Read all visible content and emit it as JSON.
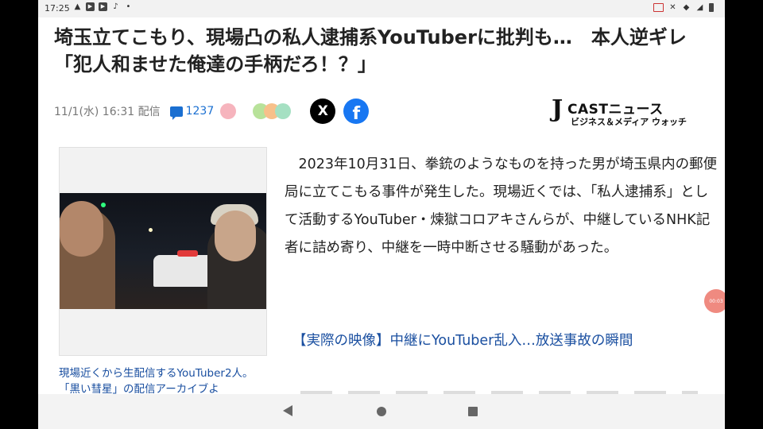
{
  "status_bar": {
    "time": "17:25"
  },
  "article": {
    "title": "埼玉立てこもり、現場凸の私人逮捕系YouTuberに批判も…　本人逆ギレ「犯人和ませた俺達の手柄だろ！？」",
    "date": "11/1(水) 16:31 配信",
    "comment_count": "1237",
    "body": "2023年10月31日、拳銃のようなものを持った男が埼玉県内の郵便局に立てこもる事件が発生した。現場近くでは、「私人逮捕系」として活動するYouTuber・煉獄コロアキさんらが、中継しているNHK記者に詰め寄り、中継を一時中断させる騒動があった。",
    "related_link": "【実際の映像】中継にYouTuber乱入…放送事故の瞬間",
    "photo_caption": "現場近くから生配信するYouTuber2人。「黒い彗星」の配信アーカイブよ"
  },
  "share": {
    "x_label": "X",
    "facebook_label": "f"
  },
  "publisher": {
    "logo_j": "J",
    "logo_main": "CASTニュース",
    "logo_sub": "ビジネス＆メディア ウォッチ"
  },
  "floating_timer": "00:03",
  "colors": {
    "link": "#1a4fa0",
    "comment": "#1a6fd1",
    "facebook": "#1877f2",
    "timer": "#ef8a80"
  }
}
